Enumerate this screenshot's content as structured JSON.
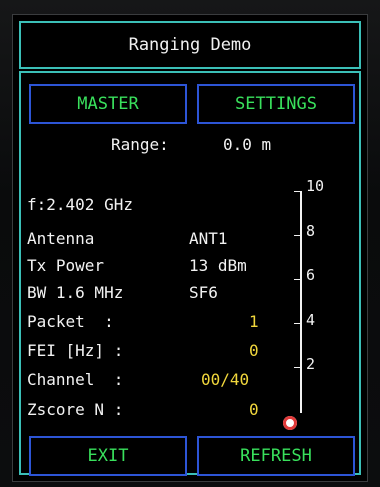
{
  "title": "Ranging Demo",
  "buttons": {
    "master": "MASTER",
    "settings": "SETTINGS",
    "exit": "EXIT",
    "refresh": "REFRESH"
  },
  "range": {
    "label": "Range:",
    "value": "0.0 m"
  },
  "info": {
    "frequency": "f:2.402 GHz",
    "antenna_label": "Antenna",
    "antenna_value": "ANT1",
    "tx_power_label": "Tx Power",
    "tx_power_value": "13 dBm",
    "bw_label": "BW 1.6 MHz",
    "sf_value": "SF6",
    "packet_label": "Packet  :",
    "packet_value": "1",
    "fei_label": "FEI [Hz] :",
    "fei_value": "0",
    "channel_label": "Channel  :",
    "channel_value": "00/40",
    "zscore_label": "Zscore N :",
    "zscore_value": "0"
  },
  "scale": {
    "labels": [
      "10",
      "8",
      "6",
      "4",
      "2"
    ],
    "level": 0
  },
  "colors": {
    "frame": "#3bbfb7",
    "button_border": "#2d55d6",
    "button_text": "#39e05c",
    "value_yellow": "#f1d73c",
    "marker": "#e13a3a"
  }
}
